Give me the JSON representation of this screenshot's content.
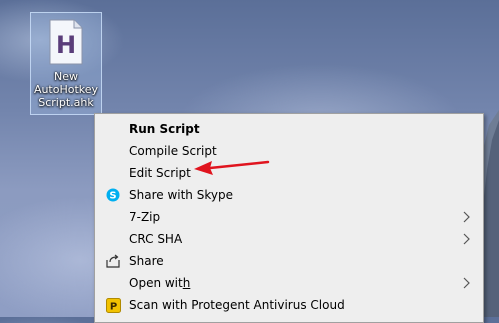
{
  "desktop": {
    "file_icon": {
      "icon": "autohotkey-file-icon",
      "glyph": "H",
      "label_lines": [
        "New",
        "AutoHotkey",
        "Script.ahk"
      ]
    }
  },
  "context_menu": {
    "items": [
      {
        "label": "Run Script",
        "icon": null,
        "bold": true
      },
      {
        "label": "Compile Script",
        "icon": null
      },
      {
        "label": "Edit Script",
        "icon": null
      },
      {
        "label": "Share with Skype",
        "icon": "skype-icon"
      },
      {
        "label": "7-Zip",
        "icon": null,
        "submenu": true
      },
      {
        "label": "CRC SHA",
        "icon": null,
        "submenu": true
      },
      {
        "label": "Share",
        "icon": "share-icon"
      },
      {
        "label_pre": "Open wit",
        "label_underlined": "h",
        "icon": null,
        "submenu": true
      },
      {
        "label": "Scan with Protegent Antivirus Cloud",
        "icon": "protegent-icon"
      }
    ]
  },
  "annotation": {
    "type": "red-arrow",
    "color": "#e0141e",
    "points_to": "Edit Script"
  },
  "colors": {
    "menu_bg": "#eeeeee",
    "skype": "#00aff0",
    "protegent": "#f2c200",
    "arrow": "#e0141e"
  }
}
